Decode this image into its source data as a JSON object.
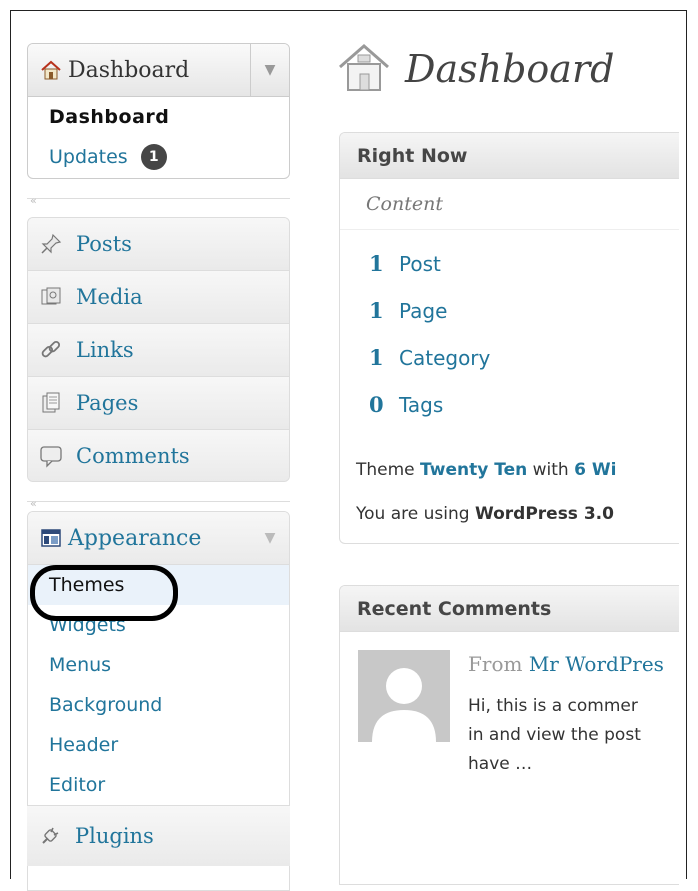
{
  "sidebar": {
    "dashboard": {
      "label": "Dashboard",
      "items": [
        {
          "label": "Dashboard",
          "current": true
        },
        {
          "label": "Updates",
          "badge": "1"
        }
      ]
    },
    "collapse_glyph": "«",
    "group1": [
      {
        "label": "Posts",
        "icon": "pushpin-icon"
      },
      {
        "label": "Media",
        "icon": "media-icon"
      },
      {
        "label": "Links",
        "icon": "link-icon"
      },
      {
        "label": "Pages",
        "icon": "pages-icon"
      },
      {
        "label": "Comments",
        "icon": "comment-bubble-icon"
      }
    ],
    "appearance": {
      "label": "Appearance",
      "items": [
        "Themes",
        "Widgets",
        "Menus",
        "Background",
        "Header",
        "Editor"
      ]
    },
    "plugins": {
      "label": "Plugins"
    }
  },
  "main": {
    "title": "Dashboard",
    "right_now": {
      "title": "Right Now",
      "content_label": "Content",
      "stats": [
        {
          "num": "1",
          "label": "Post"
        },
        {
          "num": "1",
          "label": "Page"
        },
        {
          "num": "1",
          "label": "Category"
        },
        {
          "num": "0",
          "label": "Tags"
        }
      ],
      "theme_prefix": "Theme ",
      "theme_name": "Twenty Ten",
      "theme_with": " with ",
      "theme_widgets": "6 Wi",
      "version_prefix": "You are using ",
      "version": "WordPress 3.0"
    },
    "recent_comments": {
      "title": "Recent Comments",
      "from_prefix": "From ",
      "author": "Mr WordPres",
      "text": "Hi, this is a commer\nin and view the post\nhave …"
    }
  },
  "colors": {
    "link": "#21759b",
    "annotation_circle": "#000000"
  }
}
